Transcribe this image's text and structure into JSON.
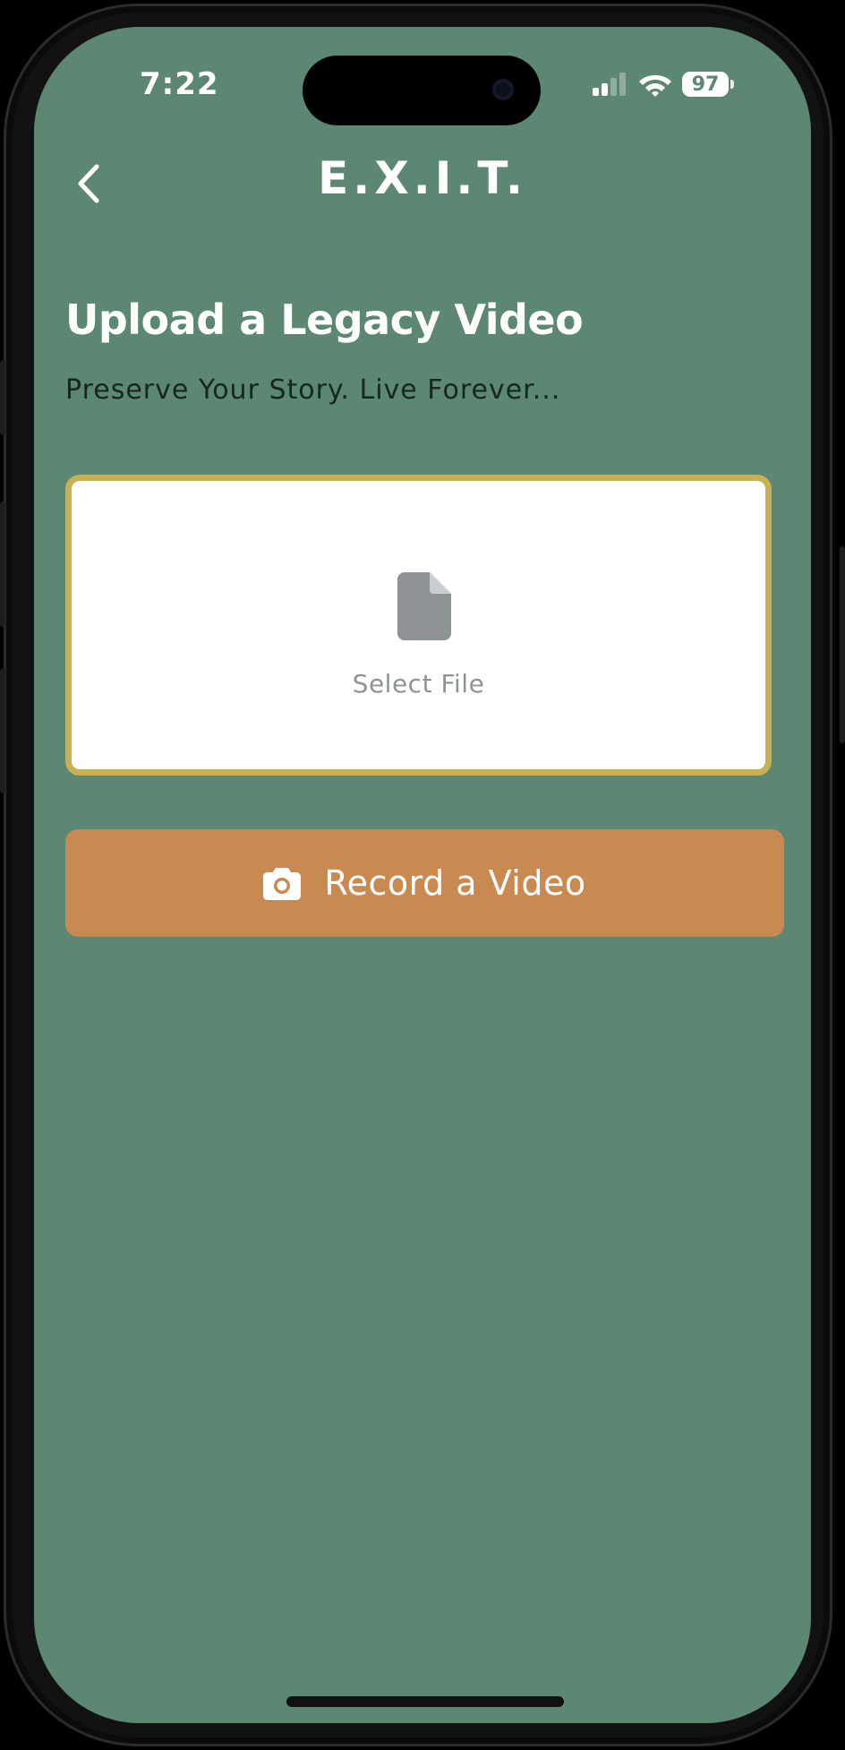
{
  "status_bar": {
    "time": "7:22",
    "battery": "97",
    "icons": [
      "signal-icon",
      "wifi-icon",
      "battery-icon"
    ]
  },
  "header": {
    "back_icon": "chevron-left-icon",
    "logo": "E.X.I.T."
  },
  "page": {
    "title": "Upload a Legacy Video",
    "subtitle": "Preserve Your Story. Live Forever..."
  },
  "file_picker": {
    "icon": "document-icon",
    "label": "Select File",
    "border_color": "#c8b150"
  },
  "record_button": {
    "icon": "camera-icon",
    "label": "Record a Video",
    "color": "#c98a52"
  },
  "colors": {
    "background": "#5c8772",
    "text_dark": "#16271e",
    "placeholder": "#8e9396"
  }
}
